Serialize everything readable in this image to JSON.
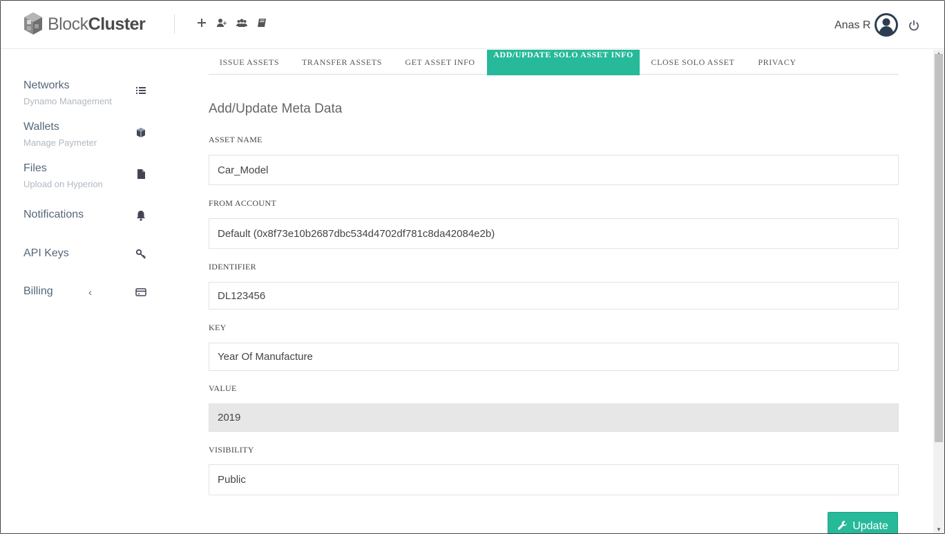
{
  "header": {
    "brand_light": "Block",
    "brand_bold": "Cluster",
    "user_name": "Anas R",
    "icons": [
      "plus-icon",
      "add-user-icon",
      "users-icon",
      "book-icon"
    ]
  },
  "sidebar": {
    "items": [
      {
        "label": "Networks",
        "sub": "Dynamo Management",
        "icon": "list-icon"
      },
      {
        "label": "Wallets",
        "sub": "Manage Paymeter",
        "icon": "cube-icon"
      },
      {
        "label": "Files",
        "sub": "Upload on Hyperion",
        "icon": "file-icon"
      },
      {
        "label": "Notifications",
        "sub": "",
        "icon": "bell-icon"
      },
      {
        "label": "API Keys",
        "sub": "",
        "icon": "key-icon"
      },
      {
        "label": "Billing",
        "sub": "",
        "chevron": "‹",
        "icon": "credit-card-icon"
      }
    ]
  },
  "tabs": [
    {
      "label": "ISSUE ASSETS"
    },
    {
      "label": "TRANSFER ASSETS"
    },
    {
      "label": "GET ASSET INFO"
    },
    {
      "label": "ADD/UPDATE SOLO ASSET INFO"
    },
    {
      "label": "CLOSE SOLO ASSET"
    },
    {
      "label": "PRIVACY"
    }
  ],
  "form": {
    "title": "Add/Update Meta Data",
    "asset_name_label": "ASSET NAME",
    "asset_name_value": "Car_Model",
    "from_account_label": "FROM ACCOUNT",
    "from_account_value": "Default (0x8f73e10b2687dbc534d4702df781c8da42084e2b)",
    "identifier_label": "IDENTIFIER",
    "identifier_value": "DL123456",
    "key_label": "KEY",
    "key_value": "Year Of Manufacture",
    "value_label": "VALUE",
    "value_value": "2019",
    "visibility_label": "VISIBILITY",
    "visibility_value": "Public",
    "update_label": "Update"
  },
  "colors": {
    "accent": "#26b99a",
    "sidebar_text": "#556677",
    "sidebar_sub": "#b0b8c0"
  }
}
